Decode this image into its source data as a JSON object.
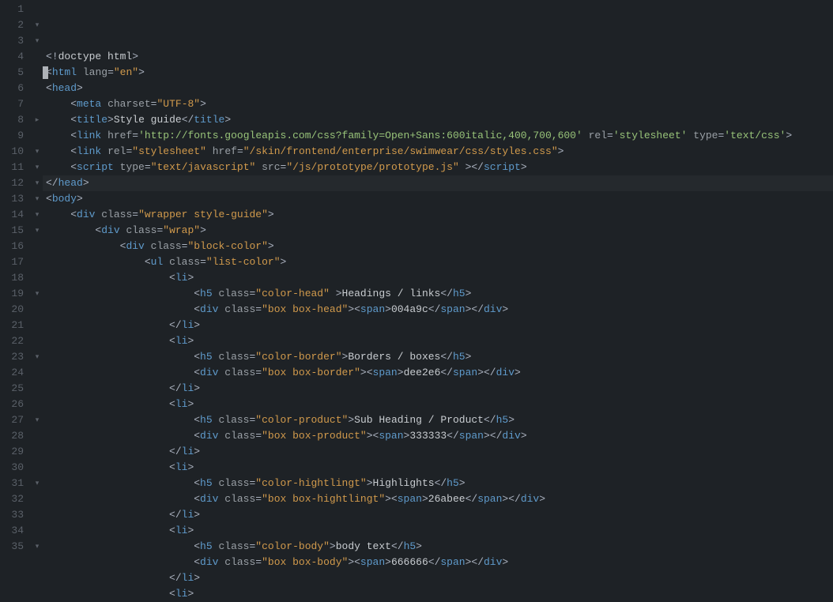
{
  "editor": {
    "highlighted_line": 12,
    "lines": [
      {
        "n": 1,
        "fold": "",
        "ind": 0,
        "seg": [
          [
            "p",
            "<!"
          ],
          [
            "dt",
            "doctype html"
          ],
          [
            "p",
            ">"
          ]
        ]
      },
      {
        "n": 2,
        "fold": "▾",
        "ind": 0,
        "seg": [
          [
            "p",
            "<"
          ],
          [
            "t",
            "html"
          ],
          [
            "p",
            " "
          ],
          [
            "a",
            "lang"
          ],
          [
            "p",
            "="
          ],
          [
            "s",
            "\"en\""
          ],
          [
            "p",
            ">"
          ]
        ]
      },
      {
        "n": 3,
        "fold": "▾",
        "ind": 0,
        "seg": [
          [
            "p",
            "<"
          ],
          [
            "t",
            "head"
          ],
          [
            "p",
            ">"
          ]
        ]
      },
      {
        "n": 4,
        "fold": "",
        "ind": 1,
        "seg": [
          [
            "p",
            "<"
          ],
          [
            "t",
            "meta"
          ],
          [
            "p",
            " "
          ],
          [
            "a",
            "charset"
          ],
          [
            "p",
            "="
          ],
          [
            "s",
            "\"UTF-8\""
          ],
          [
            "p",
            ">"
          ]
        ]
      },
      {
        "n": 5,
        "fold": "",
        "ind": 1,
        "seg": [
          [
            "p",
            "<"
          ],
          [
            "t",
            "title"
          ],
          [
            "p",
            ">"
          ],
          [
            "tx",
            "Style guide"
          ],
          [
            "p",
            "</"
          ],
          [
            "t",
            "title"
          ],
          [
            "p",
            ">"
          ]
        ]
      },
      {
        "n": 6,
        "fold": "",
        "ind": 1,
        "seg": [
          [
            "p",
            "<"
          ],
          [
            "t",
            "link"
          ],
          [
            "p",
            " "
          ],
          [
            "a",
            "href"
          ],
          [
            "p",
            "="
          ],
          [
            "sq",
            "'http://fonts.googleapis.com/css?family=Open+Sans:600italic,400,700,600'"
          ],
          [
            "p",
            " "
          ],
          [
            "a",
            "rel"
          ],
          [
            "p",
            "="
          ],
          [
            "sq",
            "'stylesheet'"
          ],
          [
            "p",
            " "
          ],
          [
            "a",
            "type"
          ],
          [
            "p",
            "="
          ],
          [
            "sq",
            "'text/css'"
          ],
          [
            "p",
            ">"
          ]
        ]
      },
      {
        "n": 7,
        "fold": "",
        "ind": 1,
        "seg": [
          [
            "p",
            "<"
          ],
          [
            "t",
            "link"
          ],
          [
            "p",
            " "
          ],
          [
            "a",
            "rel"
          ],
          [
            "p",
            "="
          ],
          [
            "s",
            "\"stylesheet\""
          ],
          [
            "p",
            " "
          ],
          [
            "a",
            "href"
          ],
          [
            "p",
            "="
          ],
          [
            "s",
            "\"/skin/frontend/enterprise/swimwear/css/styles.css\""
          ],
          [
            "p",
            ">"
          ]
        ]
      },
      {
        "n": 8,
        "fold": "▸",
        "ind": 1,
        "seg": [
          [
            "p",
            "<"
          ],
          [
            "t",
            "script"
          ],
          [
            "p",
            " "
          ],
          [
            "a",
            "type"
          ],
          [
            "p",
            "="
          ],
          [
            "s",
            "\"text/javascript\""
          ],
          [
            "p",
            " "
          ],
          [
            "a",
            "src"
          ],
          [
            "p",
            "="
          ],
          [
            "s",
            "\"/js/prototype/prototype.js\""
          ],
          [
            "p",
            " ></"
          ],
          [
            "t",
            "script"
          ],
          [
            "p",
            ">"
          ]
        ]
      },
      {
        "n": 9,
        "fold": "",
        "ind": 0,
        "seg": [
          [
            "p",
            "</"
          ],
          [
            "t",
            "head"
          ],
          [
            "p",
            ">"
          ]
        ]
      },
      {
        "n": 10,
        "fold": "▾",
        "ind": 0,
        "seg": [
          [
            "p",
            "<"
          ],
          [
            "t",
            "body"
          ],
          [
            "p",
            ">"
          ]
        ]
      },
      {
        "n": 11,
        "fold": "▾",
        "ind": 1,
        "seg": [
          [
            "p",
            "<"
          ],
          [
            "t",
            "div"
          ],
          [
            "p",
            " "
          ],
          [
            "a",
            "class"
          ],
          [
            "p",
            "="
          ],
          [
            "s",
            "\"wrapper style-guide\""
          ],
          [
            "p",
            ">"
          ]
        ]
      },
      {
        "n": 12,
        "fold": "▾",
        "ind": 2,
        "seg": [
          [
            "p",
            "<"
          ],
          [
            "t",
            "div"
          ],
          [
            "p",
            " "
          ],
          [
            "a",
            "class"
          ],
          [
            "p",
            "="
          ],
          [
            "s",
            "\"wrap\""
          ],
          [
            "p",
            ">"
          ]
        ]
      },
      {
        "n": 13,
        "fold": "▾",
        "ind": 3,
        "seg": [
          [
            "p",
            "<"
          ],
          [
            "t",
            "div"
          ],
          [
            "p",
            " "
          ],
          [
            "a",
            "class"
          ],
          [
            "p",
            "="
          ],
          [
            "s",
            "\"block-color\""
          ],
          [
            "p",
            ">"
          ]
        ]
      },
      {
        "n": 14,
        "fold": "▾",
        "ind": 4,
        "seg": [
          [
            "p",
            "<"
          ],
          [
            "t",
            "ul"
          ],
          [
            "p",
            " "
          ],
          [
            "a",
            "class"
          ],
          [
            "p",
            "="
          ],
          [
            "s",
            "\"list-color\""
          ],
          [
            "p",
            ">"
          ]
        ]
      },
      {
        "n": 15,
        "fold": "▾",
        "ind": 5,
        "seg": [
          [
            "p",
            "<"
          ],
          [
            "t",
            "li"
          ],
          [
            "p",
            ">"
          ]
        ]
      },
      {
        "n": 16,
        "fold": "",
        "ind": 6,
        "seg": [
          [
            "p",
            "<"
          ],
          [
            "t",
            "h5"
          ],
          [
            "p",
            " "
          ],
          [
            "a",
            "class"
          ],
          [
            "p",
            "="
          ],
          [
            "s",
            "\"color-head\""
          ],
          [
            "p",
            " >"
          ],
          [
            "tx",
            "Headings / links"
          ],
          [
            "p",
            "</"
          ],
          [
            "t",
            "h5"
          ],
          [
            "p",
            ">"
          ]
        ]
      },
      {
        "n": 17,
        "fold": "",
        "ind": 6,
        "seg": [
          [
            "p",
            "<"
          ],
          [
            "t",
            "div"
          ],
          [
            "p",
            " "
          ],
          [
            "a",
            "class"
          ],
          [
            "p",
            "="
          ],
          [
            "s",
            "\"box box-head\""
          ],
          [
            "p",
            "><"
          ],
          [
            "t",
            "span"
          ],
          [
            "p",
            ">"
          ],
          [
            "tx",
            "004a9c"
          ],
          [
            "p",
            "</"
          ],
          [
            "t",
            "span"
          ],
          [
            "p",
            "></"
          ],
          [
            "t",
            "div"
          ],
          [
            "p",
            ">"
          ]
        ]
      },
      {
        "n": 18,
        "fold": "",
        "ind": 5,
        "seg": [
          [
            "p",
            "</"
          ],
          [
            "t",
            "li"
          ],
          [
            "p",
            ">"
          ]
        ]
      },
      {
        "n": 19,
        "fold": "▾",
        "ind": 5,
        "seg": [
          [
            "p",
            "<"
          ],
          [
            "t",
            "li"
          ],
          [
            "p",
            ">"
          ]
        ]
      },
      {
        "n": 20,
        "fold": "",
        "ind": 6,
        "seg": [
          [
            "p",
            "<"
          ],
          [
            "t",
            "h5"
          ],
          [
            "p",
            " "
          ],
          [
            "a",
            "class"
          ],
          [
            "p",
            "="
          ],
          [
            "s",
            "\"color-border\""
          ],
          [
            "p",
            ">"
          ],
          [
            "tx",
            "Borders / boxes"
          ],
          [
            "p",
            "</"
          ],
          [
            "t",
            "h5"
          ],
          [
            "p",
            ">"
          ]
        ]
      },
      {
        "n": 21,
        "fold": "",
        "ind": 6,
        "seg": [
          [
            "p",
            "<"
          ],
          [
            "t",
            "div"
          ],
          [
            "p",
            " "
          ],
          [
            "a",
            "class"
          ],
          [
            "p",
            "="
          ],
          [
            "s",
            "\"box box-border\""
          ],
          [
            "p",
            "><"
          ],
          [
            "t",
            "span"
          ],
          [
            "p",
            ">"
          ],
          [
            "tx",
            "dee2e6"
          ],
          [
            "p",
            "</"
          ],
          [
            "t",
            "span"
          ],
          [
            "p",
            "></"
          ],
          [
            "t",
            "div"
          ],
          [
            "p",
            ">"
          ]
        ]
      },
      {
        "n": 22,
        "fold": "",
        "ind": 5,
        "seg": [
          [
            "p",
            "</"
          ],
          [
            "t",
            "li"
          ],
          [
            "p",
            ">"
          ]
        ]
      },
      {
        "n": 23,
        "fold": "▾",
        "ind": 5,
        "seg": [
          [
            "p",
            "<"
          ],
          [
            "t",
            "li"
          ],
          [
            "p",
            ">"
          ]
        ]
      },
      {
        "n": 24,
        "fold": "",
        "ind": 6,
        "seg": [
          [
            "p",
            "<"
          ],
          [
            "t",
            "h5"
          ],
          [
            "p",
            " "
          ],
          [
            "a",
            "class"
          ],
          [
            "p",
            "="
          ],
          [
            "s",
            "\"color-product\""
          ],
          [
            "p",
            ">"
          ],
          [
            "tx",
            "Sub Heading / Product"
          ],
          [
            "p",
            "</"
          ],
          [
            "t",
            "h5"
          ],
          [
            "p",
            ">"
          ]
        ]
      },
      {
        "n": 25,
        "fold": "",
        "ind": 6,
        "seg": [
          [
            "p",
            "<"
          ],
          [
            "t",
            "div"
          ],
          [
            "p",
            " "
          ],
          [
            "a",
            "class"
          ],
          [
            "p",
            "="
          ],
          [
            "s",
            "\"box box-product\""
          ],
          [
            "p",
            "><"
          ],
          [
            "t",
            "span"
          ],
          [
            "p",
            ">"
          ],
          [
            "tx",
            "333333"
          ],
          [
            "p",
            "</"
          ],
          [
            "t",
            "span"
          ],
          [
            "p",
            "></"
          ],
          [
            "t",
            "div"
          ],
          [
            "p",
            ">"
          ]
        ]
      },
      {
        "n": 26,
        "fold": "",
        "ind": 5,
        "seg": [
          [
            "p",
            "</"
          ],
          [
            "t",
            "li"
          ],
          [
            "p",
            ">"
          ]
        ]
      },
      {
        "n": 27,
        "fold": "▾",
        "ind": 5,
        "seg": [
          [
            "p",
            "<"
          ],
          [
            "t",
            "li"
          ],
          [
            "p",
            ">"
          ]
        ]
      },
      {
        "n": 28,
        "fold": "",
        "ind": 6,
        "seg": [
          [
            "p",
            "<"
          ],
          [
            "t",
            "h5"
          ],
          [
            "p",
            " "
          ],
          [
            "a",
            "class"
          ],
          [
            "p",
            "="
          ],
          [
            "s",
            "\"color-hightlingt\""
          ],
          [
            "p",
            ">"
          ],
          [
            "tx",
            "Highlights"
          ],
          [
            "p",
            "</"
          ],
          [
            "t",
            "h5"
          ],
          [
            "p",
            ">"
          ]
        ]
      },
      {
        "n": 29,
        "fold": "",
        "ind": 6,
        "seg": [
          [
            "p",
            "<"
          ],
          [
            "t",
            "div"
          ],
          [
            "p",
            " "
          ],
          [
            "a",
            "class"
          ],
          [
            "p",
            "="
          ],
          [
            "s",
            "\"box box-hightlingt\""
          ],
          [
            "p",
            "><"
          ],
          [
            "t",
            "span"
          ],
          [
            "p",
            ">"
          ],
          [
            "tx",
            "26abee"
          ],
          [
            "p",
            "</"
          ],
          [
            "t",
            "span"
          ],
          [
            "p",
            "></"
          ],
          [
            "t",
            "div"
          ],
          [
            "p",
            ">"
          ]
        ]
      },
      {
        "n": 30,
        "fold": "",
        "ind": 5,
        "seg": [
          [
            "p",
            "</"
          ],
          [
            "t",
            "li"
          ],
          [
            "p",
            ">"
          ]
        ]
      },
      {
        "n": 31,
        "fold": "▾",
        "ind": 5,
        "seg": [
          [
            "p",
            "<"
          ],
          [
            "t",
            "li"
          ],
          [
            "p",
            ">"
          ]
        ]
      },
      {
        "n": 32,
        "fold": "",
        "ind": 6,
        "seg": [
          [
            "p",
            "<"
          ],
          [
            "t",
            "h5"
          ],
          [
            "p",
            " "
          ],
          [
            "a",
            "class"
          ],
          [
            "p",
            "="
          ],
          [
            "s",
            "\"color-body\""
          ],
          [
            "p",
            ">"
          ],
          [
            "tx",
            "body text"
          ],
          [
            "p",
            "</"
          ],
          [
            "t",
            "h5"
          ],
          [
            "p",
            ">"
          ]
        ]
      },
      {
        "n": 33,
        "fold": "",
        "ind": 6,
        "seg": [
          [
            "p",
            "<"
          ],
          [
            "t",
            "div"
          ],
          [
            "p",
            " "
          ],
          [
            "a",
            "class"
          ],
          [
            "p",
            "="
          ],
          [
            "s",
            "\"box box-body\""
          ],
          [
            "p",
            "><"
          ],
          [
            "t",
            "span"
          ],
          [
            "p",
            ">"
          ],
          [
            "tx",
            "666666"
          ],
          [
            "p",
            "</"
          ],
          [
            "t",
            "span"
          ],
          [
            "p",
            "></"
          ],
          [
            "t",
            "div"
          ],
          [
            "p",
            ">"
          ]
        ]
      },
      {
        "n": 34,
        "fold": "",
        "ind": 5,
        "seg": [
          [
            "p",
            "</"
          ],
          [
            "t",
            "li"
          ],
          [
            "p",
            ">"
          ]
        ]
      },
      {
        "n": 35,
        "fold": "▾",
        "ind": 5,
        "seg": [
          [
            "p",
            "<"
          ],
          [
            "t",
            "li"
          ],
          [
            "p",
            ">"
          ]
        ]
      }
    ]
  }
}
